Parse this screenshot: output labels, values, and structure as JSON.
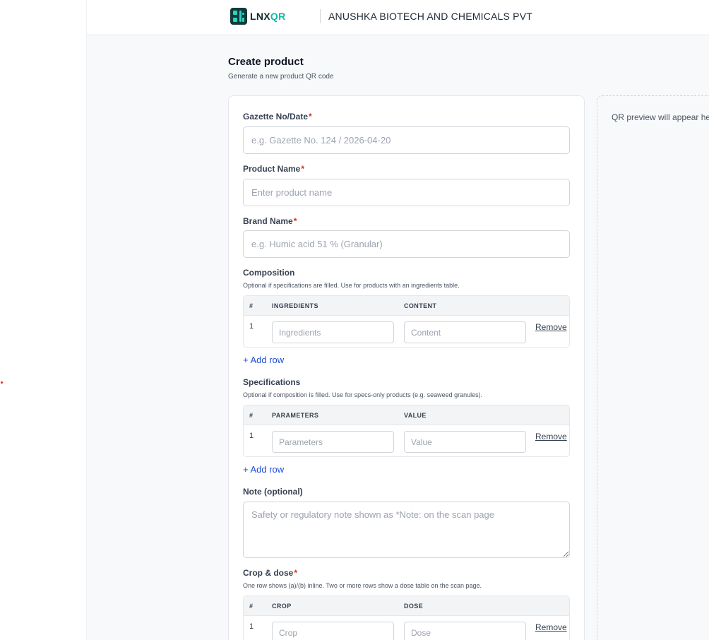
{
  "app": {
    "logo_part1": "LNX",
    "logo_part2": "QR",
    "company": "ANUSHKA BIOTECH AND CHEMICALS PVT"
  },
  "page": {
    "title": "Create product",
    "subtitle": "Generate a new product QR code"
  },
  "form": {
    "required_mark": "*",
    "gazette": {
      "label": "Gazette No/Date",
      "placeholder": "e.g. Gazette No. 124 / 2026-04-20",
      "value": ""
    },
    "product_name": {
      "label": "Product Name",
      "placeholder": "Enter product name",
      "value": ""
    },
    "brand_name": {
      "label": "Brand Name",
      "placeholder": "e.g. Humic acid 51 % (Granular)",
      "value": ""
    },
    "composition": {
      "label": "Composition",
      "hint": "Optional if specifications are filled. Use for products with an ingredients table.",
      "col_num": "#",
      "col_a": "INGREDIENTS",
      "col_b": "CONTENT",
      "rows": [
        {
          "num": "1",
          "a_placeholder": "Ingredients",
          "b_placeholder": "Content",
          "remove": "Remove"
        }
      ],
      "add_row": "+ Add row"
    },
    "specifications": {
      "label": "Specifications",
      "hint": "Optional if composition is filled. Use for specs-only products (e.g. seaweed granules).",
      "col_num": "#",
      "col_a": "PARAMETERS",
      "col_b": "VALUE",
      "rows": [
        {
          "num": "1",
          "a_placeholder": "Parameters",
          "b_placeholder": "Value",
          "remove": "Remove"
        }
      ],
      "add_row": "+ Add row"
    },
    "note": {
      "label": "Note (optional)",
      "placeholder": "Safety or regulatory note shown as *Note: on the scan page",
      "value": ""
    },
    "crop_dose": {
      "label": "Crop & dose",
      "hint": "One row shows (a)/(b) inline. Two or more rows show a dose table on the scan page.",
      "col_num": "#",
      "col_a": "CROP",
      "col_b": "DOSE",
      "rows": [
        {
          "num": "1",
          "a_placeholder": "Crop",
          "b_placeholder": "Dose",
          "remove": "Remove"
        }
      ]
    }
  },
  "preview": {
    "placeholder": "QR preview will appear here"
  },
  "colors": {
    "brand_dark": "#0f3b3a",
    "brand_accent": "#14b8a6",
    "required": "#dc2626",
    "link": "#1d4ed8"
  }
}
